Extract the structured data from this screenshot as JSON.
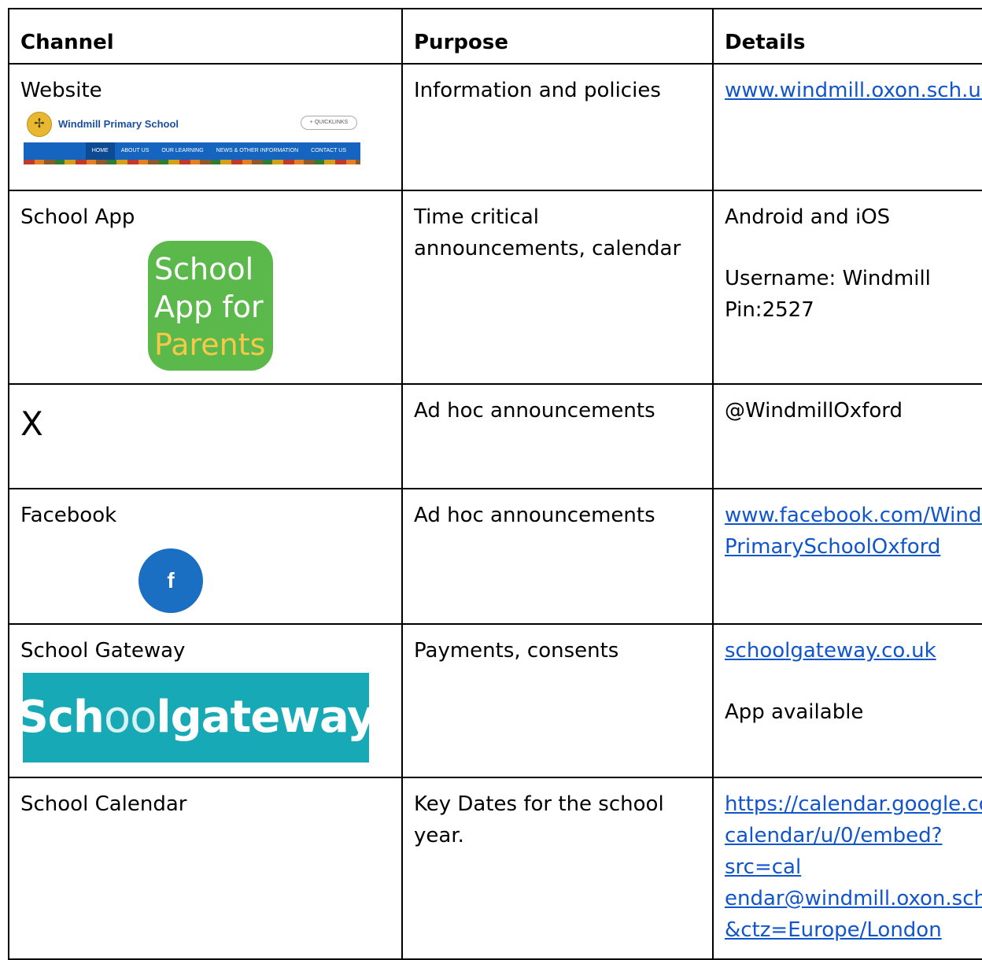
{
  "headers": {
    "channel": "Channel",
    "purpose": "Purpose",
    "details": "Details"
  },
  "rows": [
    {
      "channel": "Website",
      "purpose": "Information and policies",
      "details_link": "www.windmill.oxon.sch.uk",
      "website_preview": {
        "school_name": "Windmill Primary School",
        "quicklinks": "+ QUICKLINKS",
        "nav": [
          "HOME",
          "ABOUT US",
          "OUR LEARNING",
          "NEWS & OTHER INFORMATION",
          "CONTACT US"
        ]
      }
    },
    {
      "channel": "School App",
      "purpose": "Time critical announcements, calendar",
      "details_line1": "Android and iOS",
      "details_line2": "Username: Windmill",
      "details_line3": "Pin:2527",
      "app_icon": {
        "line1": "School",
        "line2": "App for",
        "line3": "Parents"
      }
    },
    {
      "channel": "X",
      "purpose": "Ad hoc announcements",
      "details": "@WindmillOxford"
    },
    {
      "channel": "Facebook",
      "purpose": "Ad hoc announcements",
      "details_link": "www.facebook.com/WindmillPrimarySchoolOxford",
      "details_link_part1": "www.facebook.com/Windmill",
      "details_link_part2": "PrimarySchoolOxford",
      "icon_letter": "f"
    },
    {
      "channel": "School Gateway",
      "purpose": "Payments, consents",
      "details_link": "schoolgateway.co.uk",
      "details_note": "App available",
      "logo_text_a": "Sch",
      "logo_text_b": "oo",
      "logo_text_c": "lgateway"
    },
    {
      "channel": "School Calendar",
      "purpose": "Key Dates for the school year.",
      "details_link_lines": [
        "https://calendar.google.com/",
        "calendar/u/0/embed?src=cal",
        "endar@windmill.oxon.sch.uk",
        "&ctz=Europe/London"
      ]
    }
  ],
  "colors": {
    "link": "#1155cc",
    "app_green": "#5bb84a",
    "facebook_blue": "#1a6fc2",
    "gateway_teal": "#17a9b5"
  }
}
